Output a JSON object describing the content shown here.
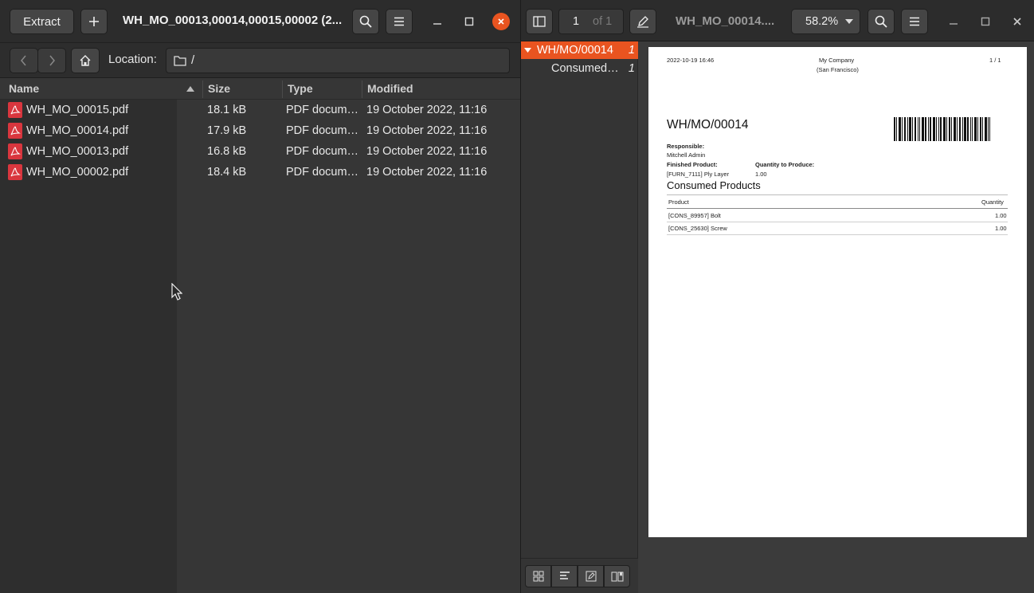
{
  "archive": {
    "extract_label": "Extract",
    "window_title": "WH_MO_00013,00014,00015,00002 (2...",
    "location_label": "Location:",
    "location_path": "/",
    "columns": {
      "name": "Name",
      "size": "Size",
      "type": "Type",
      "modified": "Modified"
    },
    "files": [
      {
        "name": "WH_MO_00015.pdf",
        "size": "18.1 kB",
        "type": "PDF docum…",
        "modified": "19 October 2022, 11:16"
      },
      {
        "name": "WH_MO_00014.pdf",
        "size": "17.9 kB",
        "type": "PDF docum…",
        "modified": "19 October 2022, 11:16"
      },
      {
        "name": "WH_MO_00013.pdf",
        "size": "16.8 kB",
        "type": "PDF docum…",
        "modified": "19 October 2022, 11:16"
      },
      {
        "name": "WH_MO_00002.pdf",
        "size": "18.4 kB",
        "type": "PDF docum…",
        "modified": "19 October 2022, 11:16"
      }
    ]
  },
  "viewer": {
    "page_current": "1",
    "page_of": "of 1",
    "window_title": "WH_MO_00014....",
    "zoom": "58.2%",
    "outline": [
      {
        "label": "WH/MO/00014",
        "page": "1"
      },
      {
        "label": "Consumed…",
        "page": "1"
      }
    ],
    "document": {
      "datetime": "2022-10-19 16:46",
      "company": "My Company",
      "company_city": "(San Francisco)",
      "page_counter": "1  /  1",
      "title": "WH/MO/00014",
      "responsible_label": "Responsible:",
      "responsible_value": "Mitchell Admin",
      "finished_label": "Finished Product:",
      "finished_value": "[FURN_7111] Ply Layer",
      "qty_label": "Quantity to Produce:",
      "qty_value": "1.00",
      "consumed_heading": "Consumed Products",
      "table_header_product": "Product",
      "table_header_quantity": "Quantity",
      "rows": [
        {
          "product": "[CONS_89957] Bolt",
          "quantity": "1.00"
        },
        {
          "product": "[CONS_25630] Screw",
          "quantity": "1.00"
        }
      ]
    }
  },
  "colors": {
    "accent": "#e95420",
    "pdf_icon": "#d9363e"
  }
}
